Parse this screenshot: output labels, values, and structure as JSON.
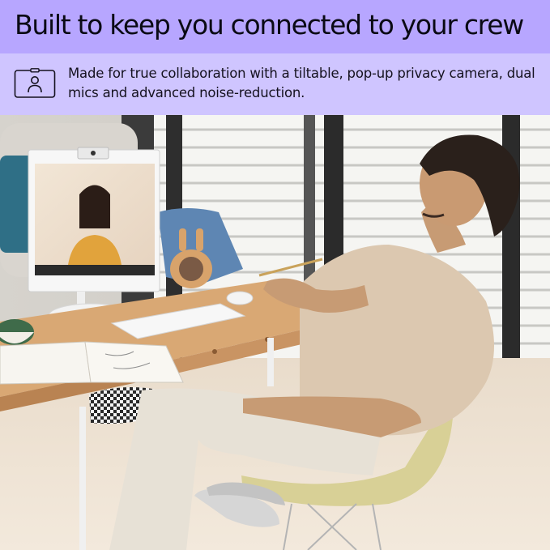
{
  "banner": {
    "headline": "Built to keep you connected to your crew",
    "description": "Made for true collaboration with a tiltable, pop-up privacy camera, dual mics and advanced noise-reduction.",
    "icon": "webcam-person-icon"
  },
  "colors": {
    "headline_bg": "#b7a6ff",
    "description_bg": "#cfc5ff",
    "text": "#0a0a14"
  }
}
